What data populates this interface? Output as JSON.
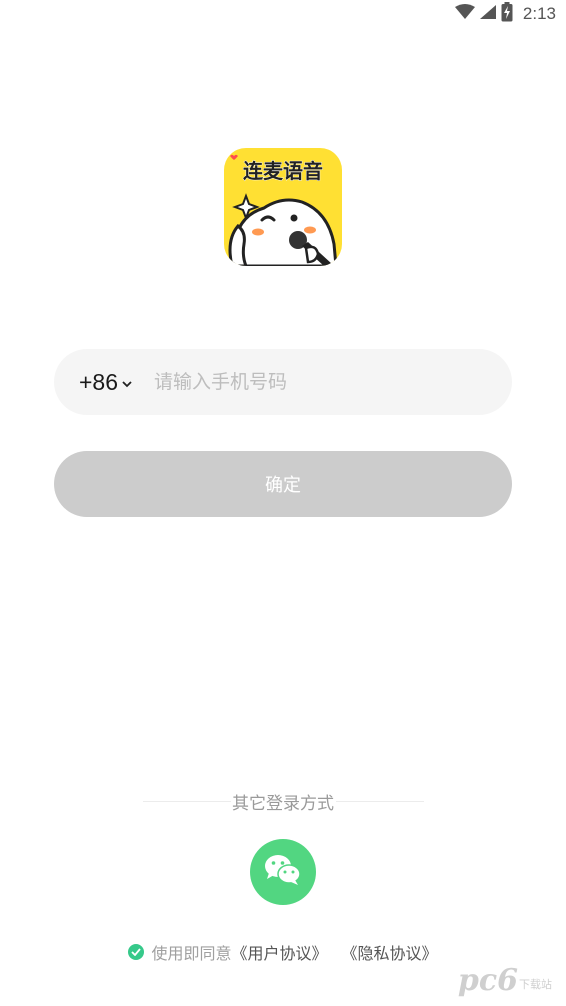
{
  "status_bar": {
    "time": "2:13",
    "icons": [
      "wifi-icon",
      "cell-signal-icon",
      "battery-charging-icon"
    ]
  },
  "logo": {
    "app_name": "连麦语音",
    "colors": {
      "background": "#ffe033",
      "mascot": "#ffffff",
      "outline": "#222222"
    }
  },
  "login": {
    "country_code": "+86",
    "phone_placeholder": "请输入手机号码",
    "phone_value": "",
    "confirm_label": "确定"
  },
  "other_login": {
    "label": "其它登录方式",
    "wechat_icon": "wechat-icon"
  },
  "agreement": {
    "prefix": "使用即同意",
    "user_agreement": "《用户协议》",
    "privacy_agreement": "《隐私协议》"
  },
  "watermark": {
    "text": "pc6",
    "sub": "下载站"
  },
  "colors": {
    "accent_green": "#52d681",
    "check_green": "#36c98a",
    "button_disabled": "#cccccc",
    "input_bg": "#f5f5f5"
  }
}
